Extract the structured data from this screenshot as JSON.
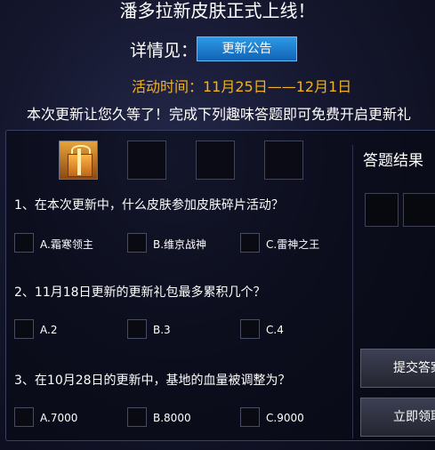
{
  "header": {
    "title": "潘多拉新皮肤正式上线！",
    "detail_label": "详情见：",
    "update_button": "更新公告",
    "activity_time": "活动时间：11月25日——12月1日",
    "intro": "本次更新让您久等了！完成下列趣味答题即可免费开启更新礼"
  },
  "reward_slots": [
    {
      "icon": "gift-box-icon",
      "filled": true
    },
    {
      "filled": false
    },
    {
      "filled": false
    },
    {
      "filled": false
    }
  ],
  "questions": [
    {
      "text": "1、在本次更新中，什么皮肤参加皮肤碎片活动？",
      "options": [
        "A.霜寒领主",
        "B.维京战神",
        "C.雷神之王"
      ]
    },
    {
      "text": "2、11月18日更新的更新礼包最多累积几个？",
      "options": [
        "A.2",
        "B.3",
        "C.4"
      ]
    },
    {
      "text": "3、在10月28日的更新中，基地的血量被调整为？",
      "options": [
        "A.7000",
        "B.8000",
        "C.9000"
      ]
    }
  ],
  "result": {
    "title": "答题结果",
    "submit_button": "提交答案",
    "claim_button": "立即领取"
  }
}
